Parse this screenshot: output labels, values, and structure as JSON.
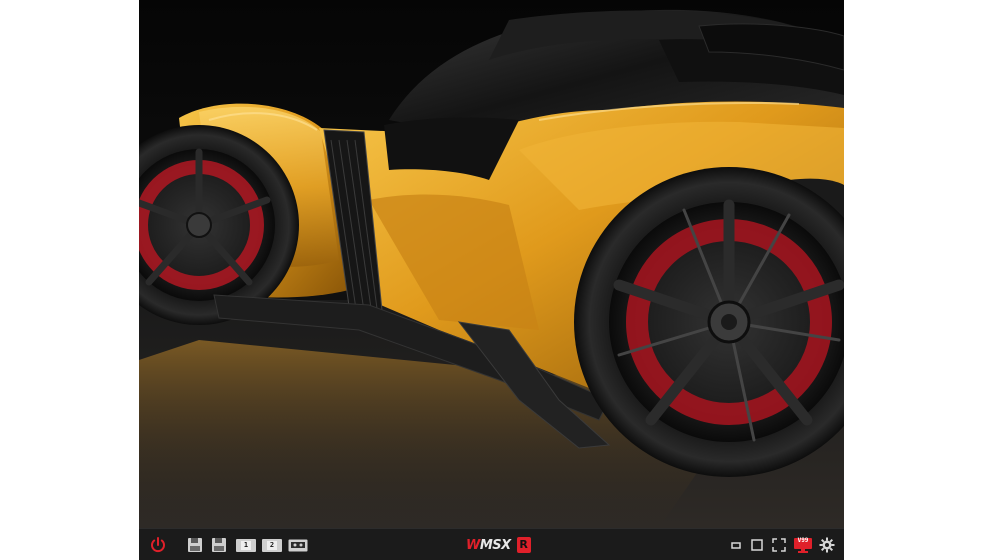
{
  "screen": {
    "description_icon": "car-wallpaper-image"
  },
  "taskbar": {
    "power": {
      "icon": "power-icon",
      "color": "#e0202a"
    },
    "disks": [
      {
        "icon": "floppy-disk-icon"
      },
      {
        "icon": "floppy-disk-icon"
      }
    ],
    "cartridges": [
      {
        "icon": "cartridge-slot-icon",
        "label": "1"
      },
      {
        "icon": "cartridge-slot-icon",
        "label": "2"
      },
      {
        "icon": "cassette-icon",
        "label": ""
      }
    ],
    "brand": {
      "text": "MSX",
      "prefix": "W",
      "badge": "R",
      "accent": "#e0202a"
    },
    "window_controls": [
      {
        "icon": "minimize-icon"
      },
      {
        "icon": "window-icon"
      },
      {
        "icon": "fullscreen-icon"
      },
      {
        "icon": "monitor-icon",
        "label": "V99"
      },
      {
        "icon": "gear-icon"
      }
    ]
  }
}
